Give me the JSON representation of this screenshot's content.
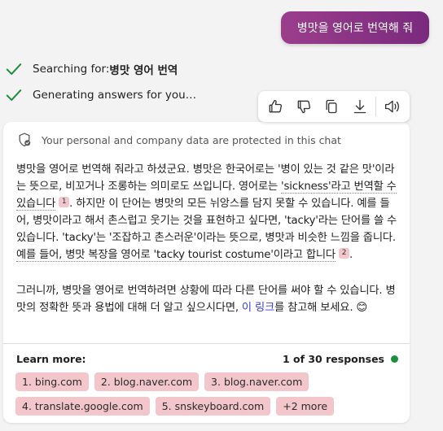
{
  "user_message": "병맛을 영어로 번역해 줘",
  "status": {
    "searching_prefix": "Searching for: ",
    "searching_query": "병맛 영어 번역",
    "generating": "Generating answers for you…"
  },
  "toolbar": {
    "icons": [
      "thumbs-up-icon",
      "thumbs-down-icon",
      "copy-icon",
      "download-icon",
      "speaker-icon"
    ]
  },
  "privacy_notice": "Your personal and company data are protected in this chat",
  "answer": {
    "p1_a": "병맛을 영어로 번역해 줘라고 하셨군요. 병맛은 한국어로는 '병이 있는 것 같은 맛'이라는 뜻으로, 비꼬거나 조롱하는 의미로도 쓰입니다. 영어로는 ",
    "p1_cite1_text": "'sickness'라고 번역할 수 있습니다",
    "cite1_num": "1",
    "p1_b": ". 하지만 이 단어는 병맛의 모든 뉘앙스를 담지 못할 수 있습니다. 예를 들어, 병맛이라고 해서 촌스럽고 웃기는 것을 표현하고 싶다면, 'tacky'라는 단어를 쓸 수 있습니다. 'tacky'는 '조잡하고 촌스러운'이라는 뜻으로, 병맛과 비슷한 느낌을 줍니다. ",
    "p1_cite2_text": "예를 들어, 병맛 복장을 영어로 'tacky tourist costume'이라고 합니다",
    "cite2_num": "2",
    "p1_end": ".",
    "p2_a": "그러니까, 병맛을 영어로 번역하려면 상황에 따라 다른 단어를 써야 할 수 있습니다. 병맛의 정확한 뜻과 용법에 대해 더 알고 싶으시다면, ",
    "p2_link": "이 링크",
    "p2_b": "를 참고해 보세요. 😊"
  },
  "learn_more": {
    "label": "Learn more:",
    "responses": "1 of 30 responses",
    "status_color": "#1e8e3e",
    "sources": [
      "1. bing.com",
      "2. blog.naver.com",
      "3. blog.naver.com",
      "4. translate.google.com",
      "5. snskeyboard.com",
      "+2 more"
    ]
  },
  "colors": {
    "accent_gradient_start": "#9b3e8c",
    "accent_gradient_end": "#7a2a7e",
    "check_green": "#1e8e3e",
    "chip_bg": "#f2c6cb",
    "link": "#3a3ad6"
  }
}
